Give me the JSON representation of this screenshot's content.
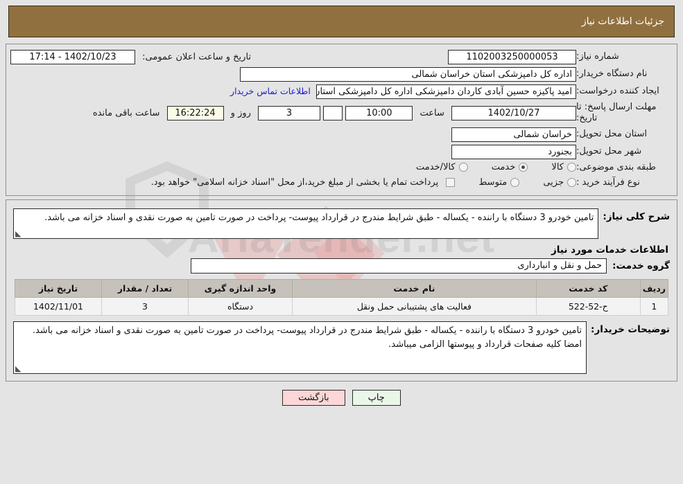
{
  "header": {
    "title": "جزئیات اطلاعات نیاز",
    "bg_color": "#91703f",
    "text_color": "#ffffff"
  },
  "watermark": {
    "text": "AriaTender.net"
  },
  "form": {
    "need_number": {
      "label": "شماره نیاز:",
      "value": "1102003250000053"
    },
    "announce_datetime": {
      "label": "تاریخ و ساعت اعلان عمومی:",
      "value": "1402/10/23 - 17:14"
    },
    "buyer_org": {
      "label": "نام دستگاه خریدار:",
      "value": "اداره کل دامپزشکی استان خراسان شمالی"
    },
    "creator": {
      "label": "ایجاد کننده درخواست:",
      "value": "امید پاکیزه حسین آبادی کاردان دامپزشکی اداره کل دامپزشکی استان خراسان شمالی",
      "contact_link": "اطلاعات تماس خریدار"
    },
    "deadline": {
      "label": "مهلت ارسال پاسخ: تا تاریخ:",
      "date": "1402/10/27",
      "time_label": "ساعت",
      "time": "10:00",
      "blank": "",
      "days": "3",
      "days_label": "روز و",
      "countdown": "16:22:24",
      "countdown_label": "ساعت باقی مانده"
    },
    "province": {
      "label": "استان محل تحویل:",
      "value": "خراسان شمالی"
    },
    "city": {
      "label": "شهر محل تحویل:",
      "value": "بجنورد"
    },
    "category": {
      "label": "طبقه بندی موضوعی:",
      "options": [
        "کالا",
        "خدمت",
        "کالا/خدمت"
      ],
      "selected": "خدمت"
    },
    "process_type": {
      "label": "نوع فرآیند خرید :",
      "options": [
        "جزیی",
        "متوسط"
      ],
      "selected": "",
      "treasury_checkbox_checked": false,
      "treasury_note": "پرداخت تمام یا بخشی از مبلغ خرید،از محل \"اسناد خزانه اسلامی\" خواهد بود."
    }
  },
  "general_description": {
    "label": "شرح کلی نیاز:",
    "value": "تامین خودرو 3 دستگاه با راننده - یکساله - طبق شرایط مندرج در قرارداد پیوست- پرداخت در صورت تامین به صورت نقدی و اسناد خزانه می باشد."
  },
  "services_section": {
    "heading": "اطلاعات خدمات مورد نیاز",
    "group_label": "گروه خدمت:",
    "group_value": "حمل و نقل و انبارداری",
    "table": {
      "columns": [
        "ردیف",
        "کد خدمت",
        "نام خدمت",
        "واحد اندازه گیری",
        "تعداد / مقدار",
        "تاریخ نیاز"
      ],
      "rows": [
        {
          "radif": "1",
          "code": "ح-52-522",
          "name": "فعالیت های پشتیبانی حمل ونقل",
          "unit": "دستگاه",
          "qty": "3",
          "date": "1402/11/01"
        }
      ]
    }
  },
  "buyer_notes": {
    "label": "توضیحات خریدار:",
    "value": "تامین خودرو 3 دستگاه با راننده - یکساله - طبق شرایط مندرج در قرارداد پیوست- پرداخت در صورت تامین به صورت نقدی و اسناد خزانه می باشد. امضا کلیه صفحات قرارداد و پیوستها الزامی میباشد."
  },
  "buttons": {
    "print": "چاپ",
    "back": "بازگشت"
  }
}
